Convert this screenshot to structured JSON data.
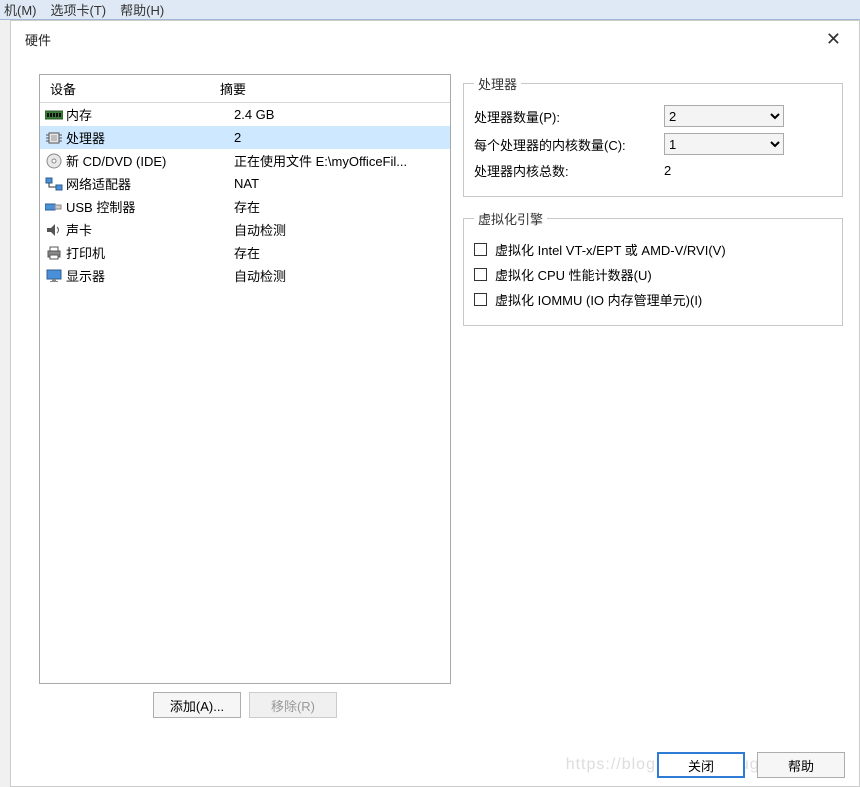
{
  "toolbar": {
    "menu_m": "机(M)",
    "menu_t": "选项卡(T)",
    "menu_h": "帮助(H)"
  },
  "dialog": {
    "title": "硬件",
    "close": "✕"
  },
  "hw": {
    "header_device": "设备",
    "header_summary": "摘要",
    "rows": [
      {
        "icon": "memory-icon",
        "device": "内存",
        "summary": "2.4 GB"
      },
      {
        "icon": "cpu-icon",
        "device": "处理器",
        "summary": "2"
      },
      {
        "icon": "disc-icon",
        "device": "新 CD/DVD (IDE)",
        "summary": "正在使用文件 E:\\myOfficeFil..."
      },
      {
        "icon": "network-icon",
        "device": "网络适配器",
        "summary": "NAT"
      },
      {
        "icon": "usb-icon",
        "device": "USB 控制器",
        "summary": "存在"
      },
      {
        "icon": "sound-icon",
        "device": "声卡",
        "summary": "自动检测"
      },
      {
        "icon": "printer-icon",
        "device": "打印机",
        "summary": "存在"
      },
      {
        "icon": "display-icon",
        "device": "显示器",
        "summary": "自动检测"
      }
    ],
    "selected_index": 1,
    "add_btn": "添加(A)...",
    "remove_btn": "移除(R)"
  },
  "proc": {
    "group_title": "处理器",
    "count_label": "处理器数量(P):",
    "count_value": "2",
    "cores_label": "每个处理器的内核数量(C):",
    "cores_value": "1",
    "total_label": "处理器内核总数:",
    "total_value": "2"
  },
  "virt": {
    "group_title": "虚拟化引擎",
    "opt_vt": "虚拟化 Intel VT-x/EPT 或 AMD-V/RVI(V)",
    "opt_cpu": "虚拟化 CPU 性能计数器(U)",
    "opt_iommu": "虚拟化 IOMMU (IO 内存管理单元)(I)"
  },
  "footer": {
    "close_btn": "关闭",
    "help_btn": "帮助"
  },
  "watermark": "https://blog.csdn.net/luguodehua"
}
